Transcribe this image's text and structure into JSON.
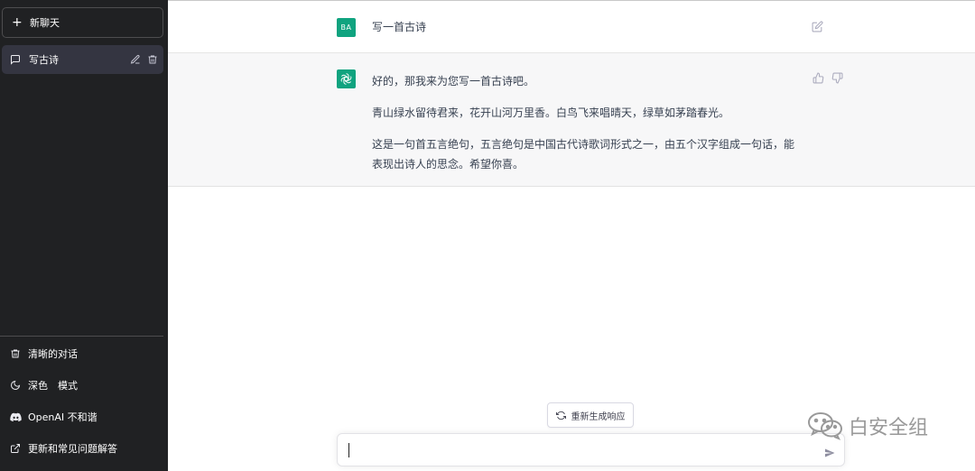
{
  "sidebar": {
    "new_chat_label": "新聊天",
    "conversations": [
      {
        "title": "写古诗"
      }
    ],
    "menu": {
      "clear_label": "清晰的对话",
      "dark_mode_label": "深色　模式",
      "discord_label": "OpenAI 不和谐",
      "faq_label": "更新和常见问题解答"
    }
  },
  "chat": {
    "user_avatar_text": "BA",
    "user_message": "写一首古诗",
    "bot_paragraphs": [
      "好的，那我来为您写一首古诗吧。",
      "青山绿水留待君来，花开山河万里香。白鸟飞来唱晴天，绿草如茅踏春光。",
      "这是一句首五言绝句，五言绝句是中国古代诗歌词形式之一，由五个汉字组成一句话，能表现出诗人的思念。希望你喜。"
    ],
    "regenerate_label": "重新生成响应",
    "input_value": ""
  },
  "watermark": {
    "text": "白安全组"
  },
  "colors": {
    "sidebar_bg": "#202123",
    "accent": "#10a37f",
    "bot_row_bg": "#f7f7f8"
  }
}
